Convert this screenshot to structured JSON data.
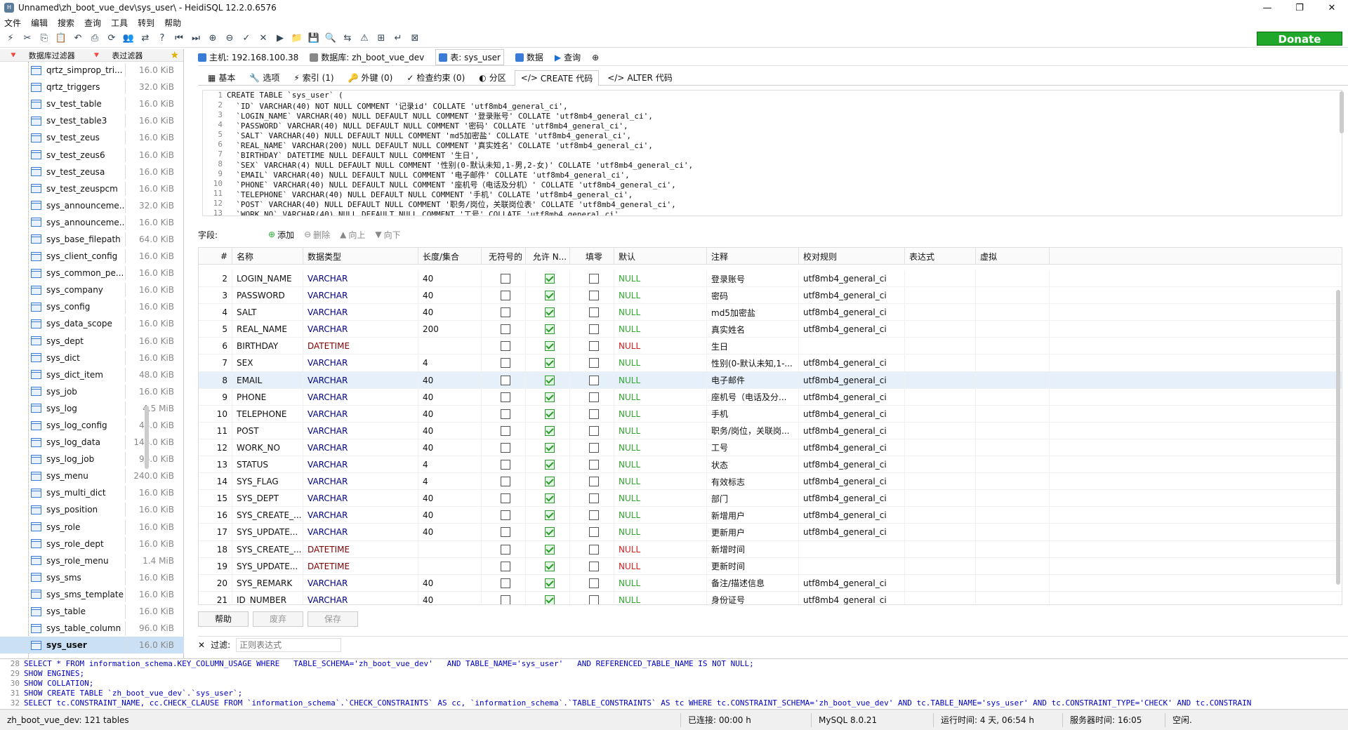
{
  "window": {
    "title": "Unnamed\\zh_boot_vue_dev\\sys_user\\ - HeidiSQL 12.2.0.6576",
    "min": "—",
    "max": "❐",
    "close": "✕"
  },
  "menu": [
    "文件",
    "编辑",
    "搜索",
    "查询",
    "工具",
    "转到",
    "帮助"
  ],
  "toolbar": {
    "donate": "Donate"
  },
  "left_filters": {
    "db_filter": "数据库过滤器",
    "table_filter": "表过滤器"
  },
  "tree": [
    {
      "name": "qrtz_simprop_tri...",
      "size": "16.0 KiB"
    },
    {
      "name": "qrtz_triggers",
      "size": "32.0 KiB"
    },
    {
      "name": "sv_test_table",
      "size": "16.0 KiB"
    },
    {
      "name": "sv_test_table3",
      "size": "16.0 KiB"
    },
    {
      "name": "sv_test_zeus",
      "size": "16.0 KiB"
    },
    {
      "name": "sv_test_zeus6",
      "size": "16.0 KiB"
    },
    {
      "name": "sv_test_zeusa",
      "size": "16.0 KiB"
    },
    {
      "name": "sv_test_zeuspcm",
      "size": "16.0 KiB"
    },
    {
      "name": "sys_announceme...",
      "size": "32.0 KiB"
    },
    {
      "name": "sys_announceme...",
      "size": "16.0 KiB"
    },
    {
      "name": "sys_base_filepath",
      "size": "64.0 KiB"
    },
    {
      "name": "sys_client_config",
      "size": "16.0 KiB"
    },
    {
      "name": "sys_common_pe...",
      "size": "16.0 KiB"
    },
    {
      "name": "sys_company",
      "size": "16.0 KiB"
    },
    {
      "name": "sys_config",
      "size": "16.0 KiB"
    },
    {
      "name": "sys_data_scope",
      "size": "16.0 KiB"
    },
    {
      "name": "sys_dept",
      "size": "16.0 KiB"
    },
    {
      "name": "sys_dict",
      "size": "16.0 KiB"
    },
    {
      "name": "sys_dict_item",
      "size": "48.0 KiB"
    },
    {
      "name": "sys_job",
      "size": "16.0 KiB"
    },
    {
      "name": "sys_log",
      "size": "4.5 MiB"
    },
    {
      "name": "sys_log_config",
      "size": "48.0 KiB"
    },
    {
      "name": "sys_log_data",
      "size": "144.0 KiB"
    },
    {
      "name": "sys_log_job",
      "size": "96.0 KiB"
    },
    {
      "name": "sys_menu",
      "size": "240.0 KiB"
    },
    {
      "name": "sys_multi_dict",
      "size": "16.0 KiB"
    },
    {
      "name": "sys_position",
      "size": "16.0 KiB"
    },
    {
      "name": "sys_role",
      "size": "16.0 KiB"
    },
    {
      "name": "sys_role_dept",
      "size": "16.0 KiB"
    },
    {
      "name": "sys_role_menu",
      "size": "1.4 MiB"
    },
    {
      "name": "sys_sms",
      "size": "16.0 KiB"
    },
    {
      "name": "sys_sms_template",
      "size": "16.0 KiB"
    },
    {
      "name": "sys_table",
      "size": "16.0 KiB"
    },
    {
      "name": "sys_table_column",
      "size": "96.0 KiB"
    },
    {
      "name": "sys_user",
      "size": "16.0 KiB",
      "selected": true
    }
  ],
  "info": {
    "host": "主机: 192.168.100.38",
    "db": "数据库: zh_boot_vue_dev",
    "table": "表: sys_user",
    "data": "数据",
    "query": "查询"
  },
  "tabs": [
    "基本",
    "选项",
    "索引 (1)",
    "外键 (0)",
    "检查约束 (0)",
    "分区",
    "CREATE 代码",
    "ALTER 代码"
  ],
  "code": [
    "CREATE TABLE `sys_user` (",
    "  `ID` VARCHAR(40) NOT NULL COMMENT '记录id' COLLATE 'utf8mb4_general_ci',",
    "  `LOGIN_NAME` VARCHAR(40) NULL DEFAULT NULL COMMENT '登录账号' COLLATE 'utf8mb4_general_ci',",
    "  `PASSWORD` VARCHAR(40) NULL DEFAULT NULL COMMENT '密码' COLLATE 'utf8mb4_general_ci',",
    "  `SALT` VARCHAR(40) NULL DEFAULT NULL COMMENT 'md5加密盐' COLLATE 'utf8mb4_general_ci',",
    "  `REAL_NAME` VARCHAR(200) NULL DEFAULT NULL COMMENT '真实姓名' COLLATE 'utf8mb4_general_ci',",
    "  `BIRTHDAY` DATETIME NULL DEFAULT NULL COMMENT '生日',",
    "  `SEX` VARCHAR(4) NULL DEFAULT NULL COMMENT '性别(0-默认未知,1-男,2-女)' COLLATE 'utf8mb4_general_ci',",
    "  `EMAIL` VARCHAR(40) NULL DEFAULT NULL COMMENT '电子邮件' COLLATE 'utf8mb4_general_ci',",
    "  `PHONE` VARCHAR(40) NULL DEFAULT NULL COMMENT '座机号（电话及分机）' COLLATE 'utf8mb4_general_ci',",
    "  `TELEPHONE` VARCHAR(40) NULL DEFAULT NULL COMMENT '手机' COLLATE 'utf8mb4_general_ci',",
    "  `POST` VARCHAR(40) NULL DEFAULT NULL COMMENT '职务/岗位，关联岗位表' COLLATE 'utf8mb4_general_ci',",
    "  `WORK_NO` VARCHAR(40) NULL DEFAULT NULL COMMENT '工号' COLLATE 'utf8mb4_general_ci',"
  ],
  "fields_bar": {
    "label": "字段:",
    "add": "添加",
    "delete": "删除",
    "up": "向上",
    "down": "向下"
  },
  "grid_headers": [
    "#",
    "名称",
    "数据类型",
    "长度/集合",
    "无符号的",
    "允许 N...",
    "填零",
    "默认",
    "注释",
    "校对规则",
    "表达式",
    "虚拟"
  ],
  "rows": [
    {
      "n": "2",
      "name": "LOGIN_NAME",
      "type": "VARCHAR",
      "len": "40",
      "def": "NULL",
      "cmt": "登录账号",
      "col": "utf8mb4_general_ci"
    },
    {
      "n": "3",
      "name": "PASSWORD",
      "type": "VARCHAR",
      "len": "40",
      "def": "NULL",
      "cmt": "密码",
      "col": "utf8mb4_general_ci"
    },
    {
      "n": "4",
      "name": "SALT",
      "type": "VARCHAR",
      "len": "40",
      "def": "NULL",
      "cmt": "md5加密盐",
      "col": "utf8mb4_general_ci"
    },
    {
      "n": "5",
      "name": "REAL_NAME",
      "type": "VARCHAR",
      "len": "200",
      "def": "NULL",
      "cmt": "真实姓名",
      "col": "utf8mb4_general_ci"
    },
    {
      "n": "6",
      "name": "BIRTHDAY",
      "type": "DATETIME",
      "len": "",
      "def": "NULL",
      "cmt": "生日",
      "col": ""
    },
    {
      "n": "7",
      "name": "SEX",
      "type": "VARCHAR",
      "len": "4",
      "def": "NULL",
      "cmt": "性别(0-默认未知,1-...",
      "col": "utf8mb4_general_ci"
    },
    {
      "n": "8",
      "name": "EMAIL",
      "type": "VARCHAR",
      "len": "40",
      "def": "NULL",
      "cmt": "电子邮件",
      "col": "utf8mb4_general_ci",
      "sel": true
    },
    {
      "n": "9",
      "name": "PHONE",
      "type": "VARCHAR",
      "len": "40",
      "def": "NULL",
      "cmt": "座机号（电话及分...",
      "col": "utf8mb4_general_ci"
    },
    {
      "n": "10",
      "name": "TELEPHONE",
      "type": "VARCHAR",
      "len": "40",
      "def": "NULL",
      "cmt": "手机",
      "col": "utf8mb4_general_ci"
    },
    {
      "n": "11",
      "name": "POST",
      "type": "VARCHAR",
      "len": "40",
      "def": "NULL",
      "cmt": "职务/岗位，关联岗...",
      "col": "utf8mb4_general_ci"
    },
    {
      "n": "12",
      "name": "WORK_NO",
      "type": "VARCHAR",
      "len": "40",
      "def": "NULL",
      "cmt": "工号",
      "col": "utf8mb4_general_ci"
    },
    {
      "n": "13",
      "name": "STATUS",
      "type": "VARCHAR",
      "len": "4",
      "def": "NULL",
      "cmt": "状态",
      "col": "utf8mb4_general_ci"
    },
    {
      "n": "14",
      "name": "SYS_FLAG",
      "type": "VARCHAR",
      "len": "4",
      "def": "NULL",
      "cmt": "有效标志",
      "col": "utf8mb4_general_ci"
    },
    {
      "n": "15",
      "name": "SYS_DEPT",
      "type": "VARCHAR",
      "len": "40",
      "def": "NULL",
      "cmt": "部门",
      "col": "utf8mb4_general_ci"
    },
    {
      "n": "16",
      "name": "SYS_CREATE_...",
      "type": "VARCHAR",
      "len": "40",
      "def": "NULL",
      "cmt": "新增用户",
      "col": "utf8mb4_general_ci"
    },
    {
      "n": "17",
      "name": "SYS_UPDATE...",
      "type": "VARCHAR",
      "len": "40",
      "def": "NULL",
      "cmt": "更新用户",
      "col": "utf8mb4_general_ci"
    },
    {
      "n": "18",
      "name": "SYS_CREATE_...",
      "type": "DATETIME",
      "len": "",
      "def": "NULL",
      "cmt": "新增时间",
      "col": ""
    },
    {
      "n": "19",
      "name": "SYS_UPDATE...",
      "type": "DATETIME",
      "len": "",
      "def": "NULL",
      "cmt": "更新时间",
      "col": ""
    },
    {
      "n": "20",
      "name": "SYS_REMARK",
      "type": "VARCHAR",
      "len": "40",
      "def": "NULL",
      "cmt": "备注/描述信息",
      "col": "utf8mb4_general_ci"
    },
    {
      "n": "21",
      "name": "ID_NUMBER",
      "type": "VARCHAR",
      "len": "40",
      "def": "NULL",
      "cmt": "身份证号",
      "col": "utf8mb4_general_ci"
    }
  ],
  "buttons": {
    "help": "帮助",
    "discard": "废弃",
    "save": "保存"
  },
  "filter": {
    "label": "过滤:",
    "placeholder": "正则表达式"
  },
  "log": [
    {
      "n": "28",
      "text": "SELECT * FROM information_schema.KEY_COLUMN_USAGE WHERE   TABLE_SCHEMA='zh_boot_vue_dev'   AND TABLE_NAME='sys_user'   AND REFERENCED_TABLE_NAME IS NOT NULL;"
    },
    {
      "n": "29",
      "text": "SHOW ENGINES;"
    },
    {
      "n": "30",
      "text": "SHOW COLLATION;"
    },
    {
      "n": "31",
      "text": "SHOW CREATE TABLE `zh_boot_vue_dev`.`sys_user`;"
    },
    {
      "n": "32",
      "text": "SELECT tc.CONSTRAINT_NAME, cc.CHECK_CLAUSE FROM `information_schema`.`CHECK_CONSTRAINTS` AS cc, `information_schema`.`TABLE_CONSTRAINTS` AS tc WHERE tc.CONSTRAINT_SCHEMA='zh_boot_vue_dev' AND tc.TABLE_NAME='sys_user' AND tc.CONSTRAINT_TYPE='CHECK' AND tc.CONSTRAIN"
    }
  ],
  "status": {
    "tables": "zh_boot_vue_dev: 121 tables",
    "connected": "已连接: 00:00 h",
    "server": "MySQL 8.0.21",
    "uptime": "运行时间: 4 天, 06:54 h",
    "server_time": "服务器时间: 16:05",
    "idle": "空闲."
  }
}
